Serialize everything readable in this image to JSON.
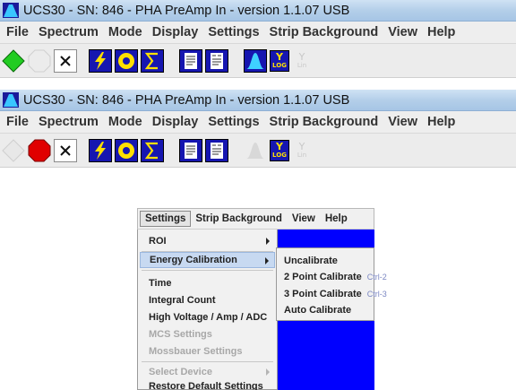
{
  "window1": {
    "title": "UCS30 - SN: 846 - PHA PreAmp In  - version 1.1.07 USB",
    "menu": [
      "File",
      "Spectrum",
      "Mode",
      "Display",
      "Settings",
      "Strip Background",
      "View",
      "Help"
    ],
    "toolbar": {
      "start": "start-icon-active",
      "stop": "stop-icon-disabled",
      "clear": "clear-icon",
      "y_log_big": "Y",
      "y_log_small": "LOG",
      "y_lin_big": "Y",
      "y_lin_small": "Lin"
    }
  },
  "window2": {
    "title": "UCS30 - SN: 846 - PHA PreAmp In  - version 1.1.07 USB",
    "menu": [
      "File",
      "Spectrum",
      "Mode",
      "Display",
      "Settings",
      "Strip Background",
      "View",
      "Help"
    ],
    "toolbar": {
      "start": "start-icon-disabled",
      "stop": "stop-icon-active",
      "clear": "clear-icon",
      "y_log_big": "Y",
      "y_log_small": "LOG",
      "y_lin_big": "Y",
      "y_lin_small": "Lin"
    }
  },
  "popup": {
    "menubar": [
      "Settings",
      "Strip Background",
      "View",
      "Help"
    ],
    "settings_items": [
      "ROI",
      "Energy Calibration",
      "Time",
      "Integral Count",
      "High Voltage / Amp / ADC",
      "MCS Settings",
      "Mossbauer Settings",
      "Select Device",
      "Restore Default Settings"
    ],
    "calibration_items": [
      {
        "label": "Uncalibrate",
        "shortcut": ""
      },
      {
        "label": "2 Point Calibrate",
        "shortcut": "Ctrl-2"
      },
      {
        "label": "3 Point Calibrate",
        "shortcut": "Ctrl-3"
      },
      {
        "label": "Auto Calibrate",
        "shortcut": ""
      }
    ]
  },
  "colors": {
    "titlebar": "#b4cfe9",
    "start_active": "#22cc22",
    "stop_active": "#e00000",
    "toolbar_icon_bg": "#1616b0",
    "toolbar_icon_fg": "#ffe000",
    "menu_highlight": "#c7d9f1",
    "background_blue": "#0000ff"
  }
}
